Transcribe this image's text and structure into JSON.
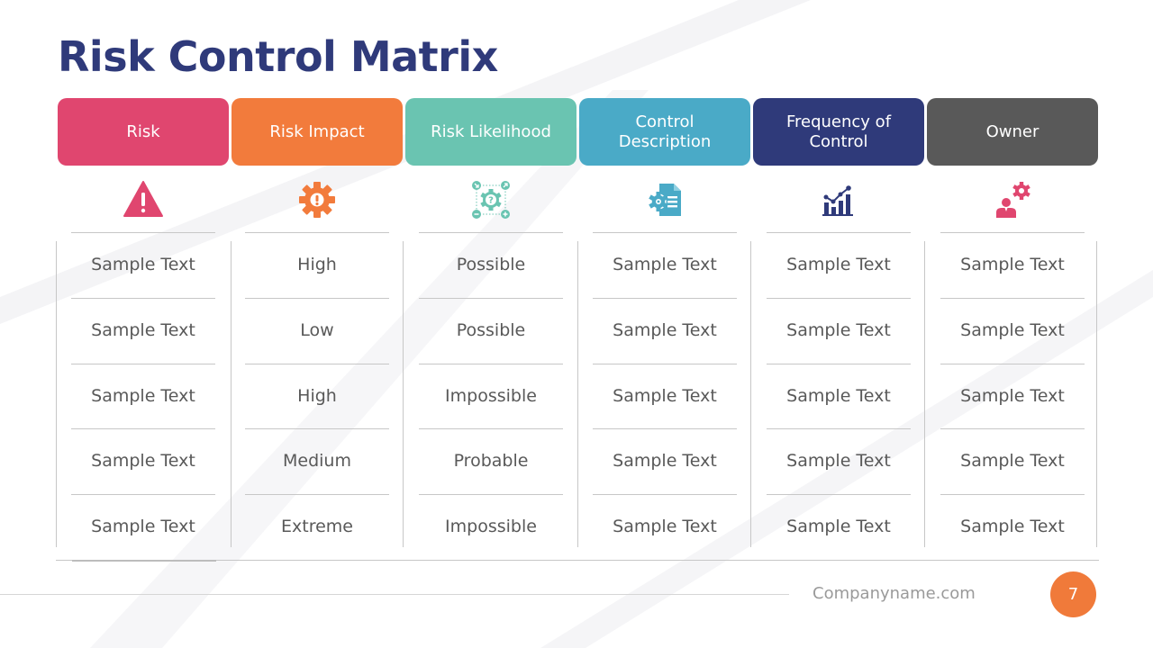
{
  "slide": {
    "title": "Risk Control Matrix",
    "footer_site": "Companyname.com",
    "page_number": "7"
  },
  "columns": [
    {
      "label": "Risk",
      "color": "#e0466f",
      "icon": "warning-triangle-icon",
      "icon_color": "#e0466f"
    },
    {
      "label": "Risk Impact",
      "color": "#f27b3c",
      "icon": "gear-alert-icon",
      "icon_color": "#f27b3c"
    },
    {
      "label": "Risk Likelihood",
      "color": "#6ac4b1",
      "icon": "gear-question-icon",
      "icon_color": "#6ac4b1"
    },
    {
      "label": "Control Description",
      "color": "#4aaac7",
      "icon": "document-gear-icon",
      "icon_color": "#4aaac7"
    },
    {
      "label": "Frequency of Control",
      "color": "#2f3a7a",
      "icon": "chart-growth-icon",
      "icon_color": "#2f3a7a"
    },
    {
      "label": "Owner",
      "color": "#595959",
      "icon": "person-gear-icon",
      "icon_color": "#e0466f"
    }
  ],
  "rows": [
    [
      "Sample Text",
      "High",
      "Possible",
      "Sample Text",
      "Sample Text",
      "Sample Text"
    ],
    [
      "Sample Text",
      "Low",
      "Possible",
      "Sample Text",
      "Sample Text",
      "Sample Text"
    ],
    [
      "Sample Text",
      "High",
      "Impossible",
      "Sample Text",
      "Sample Text",
      "Sample Text"
    ],
    [
      "Sample Text",
      "Medium",
      "Probable",
      "Sample Text",
      "Sample Text",
      "Sample Text"
    ],
    [
      "Sample Text",
      "Extreme",
      "Impossible",
      "Sample Text",
      "Sample Text",
      "Sample Text"
    ]
  ]
}
